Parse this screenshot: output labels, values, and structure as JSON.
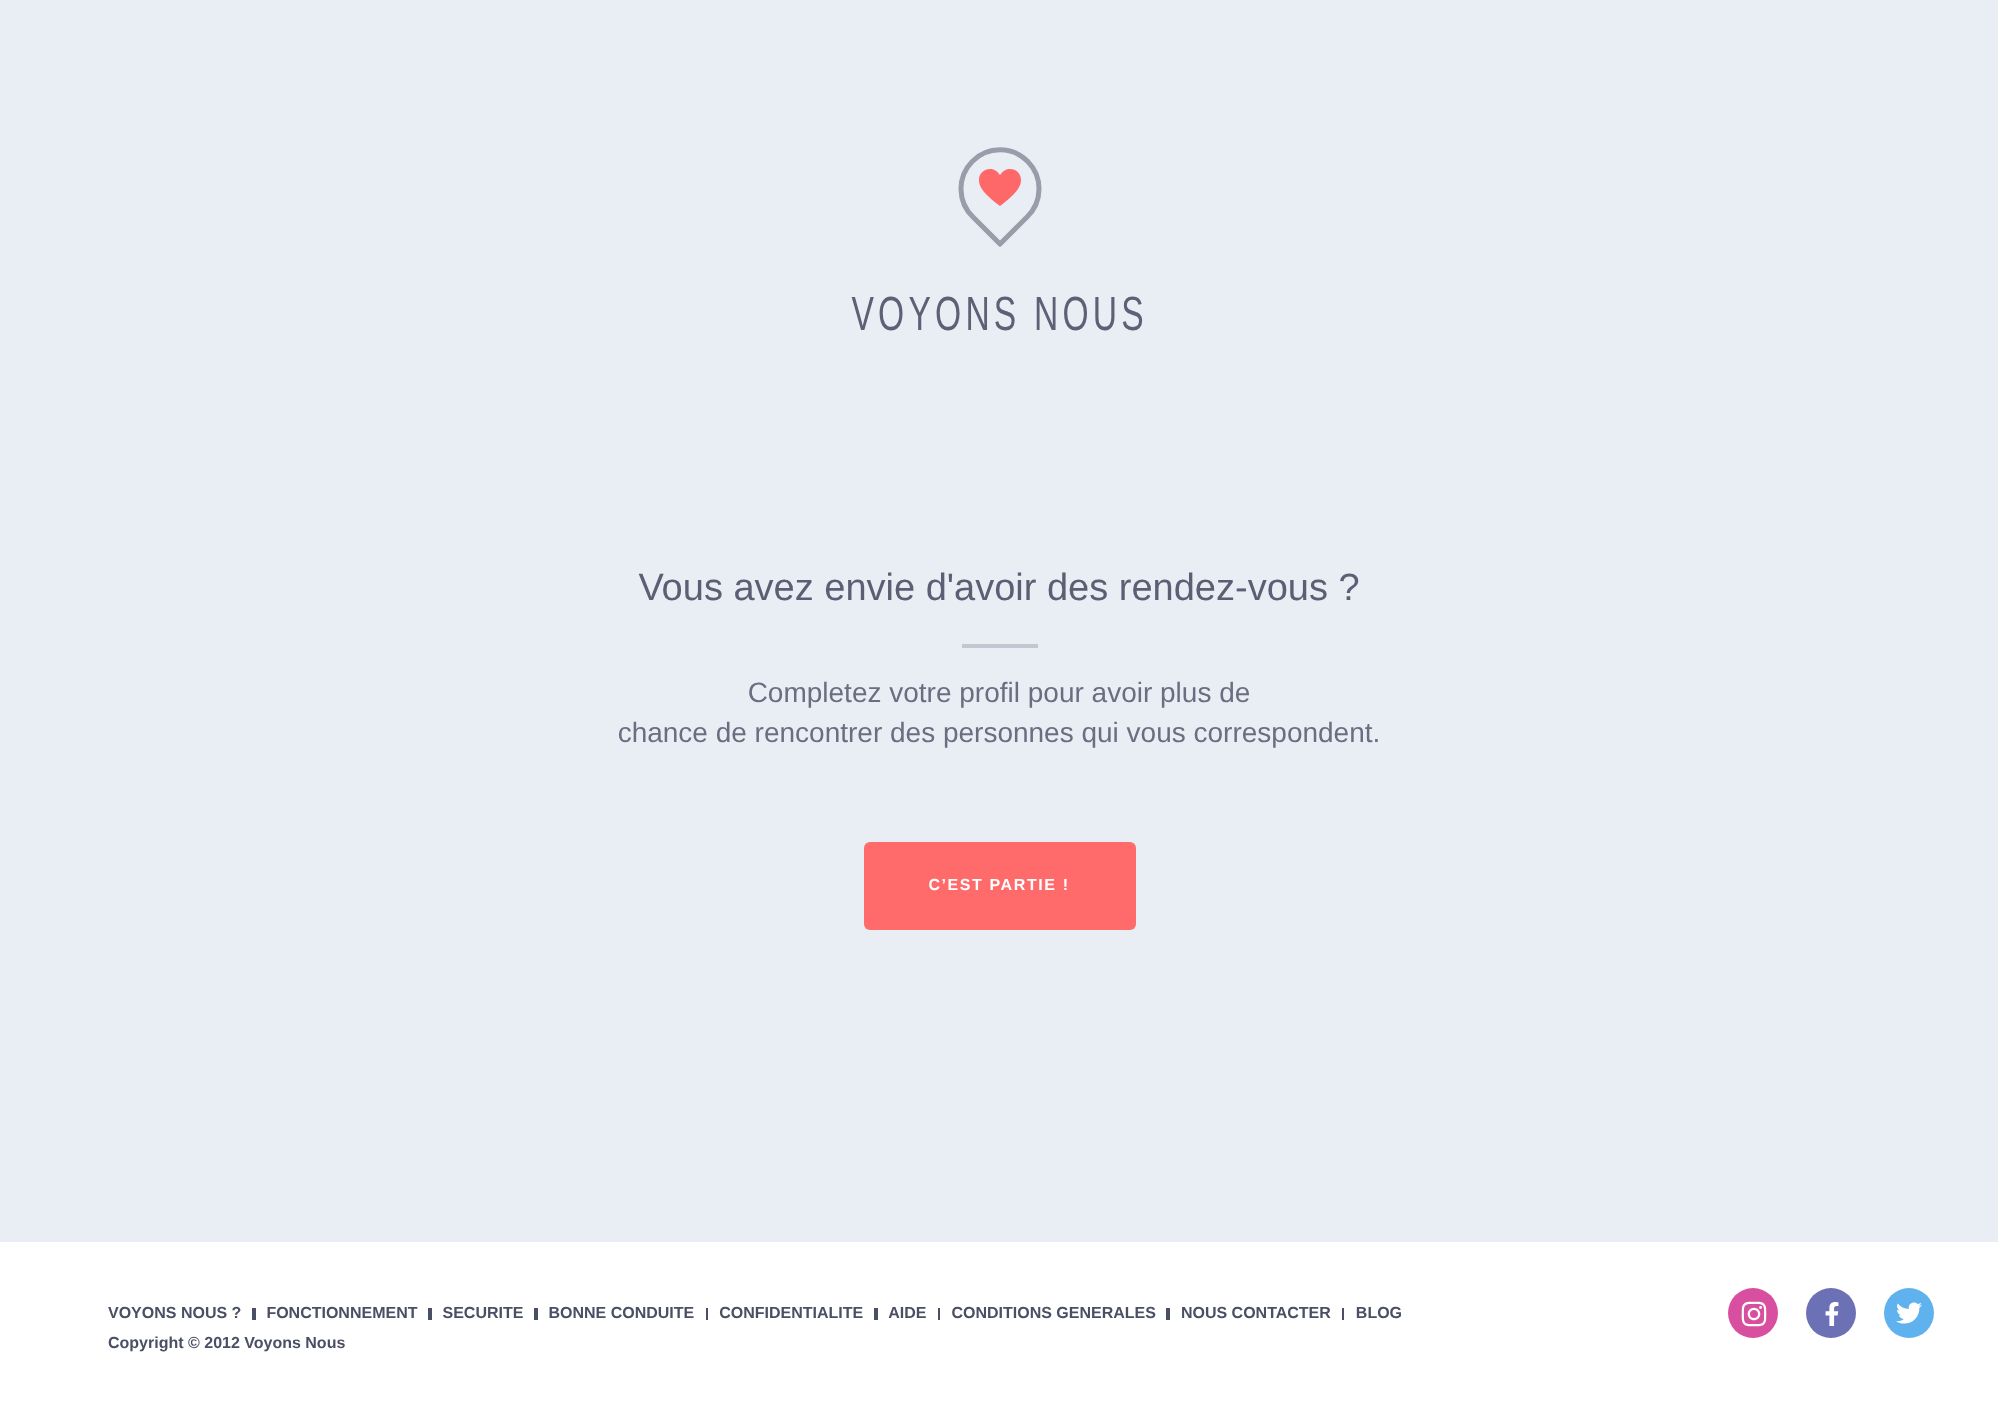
{
  "header": {
    "logo_text": "VOYONS NOUS"
  },
  "hero": {
    "heading": "Vous avez envie d'avoir des rendez-vous ?",
    "text_lines": [
      "Completez votre profil pour avoir plus de",
      "chance de rencontrer des personnes qui vous correspondent."
    ],
    "button": "C’EST PARTIE !"
  },
  "footer": {
    "links": [
      "VOYONS NOUS ?",
      "FONCTIONNEMENT",
      "SECURITE",
      "BONNE CONDUITE",
      "CONFIDENTIALITE",
      "AIDE",
      "CONDITIONS GENERALES",
      "NOUS CONTACTER",
      "BLOG"
    ],
    "copyright": "Copyright © 2012 Voyons Nous",
    "social": [
      {
        "kind": "instagram",
        "color": "#d94f9f"
      },
      {
        "kind": "facebook",
        "color": "#6c70b4"
      },
      {
        "kind": "twitter",
        "color": "#5fb2ee"
      }
    ]
  }
}
